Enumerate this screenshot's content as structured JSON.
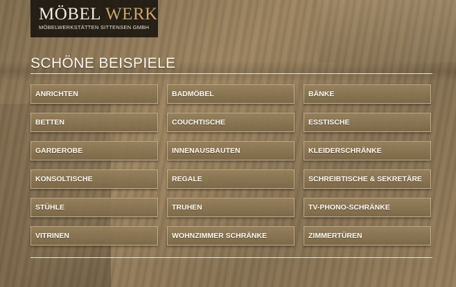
{
  "brand": {
    "name_part1": "MÖBEL",
    "name_part2": "WERK",
    "subtitle": "MÖBELWERKSTÄTTEN SITTENSEN GMBH"
  },
  "page_title": "SCHÖNE BEISPIELE",
  "categories": [
    [
      "ANRICHTEN",
      "BADMÖBEL",
      "BÄNKE"
    ],
    [
      "BETTEN",
      "COUCHTISCHE",
      "ESSTISCHE"
    ],
    [
      "GARDEROBE",
      "INNENAUSBAUTEN",
      "KLEIDERSCHRÄNKE"
    ],
    [
      "KONSOLTISCHE",
      "REGALE",
      "SCHREIBTISCHE & SEKRETÄRE"
    ],
    [
      "STÜHLE",
      "TRUHEN",
      "TV-PHONO-SCHRÄNKE"
    ],
    [
      "VITRINEN",
      "WOHNZIMMER SCHRÄNKE",
      "ZIMMERTÜREN"
    ]
  ],
  "colors": {
    "accent": "#c9a66b",
    "text_light": "#faf6ee",
    "logo_bg": "#14100c"
  }
}
